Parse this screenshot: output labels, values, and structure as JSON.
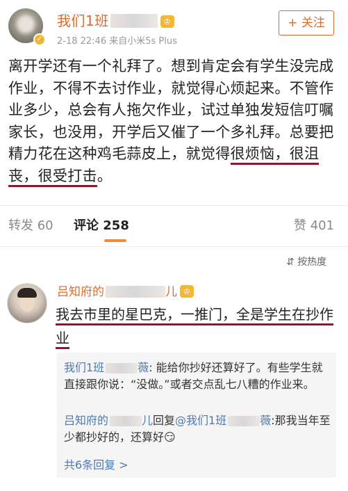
{
  "post": {
    "username": "我们1班",
    "vip_badge": "♔",
    "meta": "2-18 22:46  来自小米5s Plus",
    "follow_label": "+ 关注",
    "text_before_underline": "离开学还有一个礼拜了。想到肯定会有学生没完成作业，不得不去讨作业，就觉得心烦起来。不管作业多少，总会有人拖欠作业，试过单独发短信叮嘱家长，也没用，开学后又催了一个多礼拜。总要把精力花在这种鸡毛蒜皮上，就觉得",
    "text_underlined": "很烦恼，很沮丧，很受打击",
    "text_after_underline": "。"
  },
  "stats": {
    "repost": "转发 60",
    "comments": "评论 258",
    "likes": "赞 401"
  },
  "sort_label": "按热度",
  "sort_icon": "⇵",
  "comment": {
    "username": "吕知府的",
    "username_suffix": "儿",
    "text": "我去市里的星巴克，一推门，全是学生在抄作业"
  },
  "replies": [
    {
      "name": "我们1班",
      "name_tail": "薇",
      "text": ": 能给你抄好还算好了。有些学生就直接跟你说：“没做。”或者交点乱七八糟的作业来。"
    },
    {
      "name": "吕知府的",
      "name_tail": "儿",
      "text_prefix": "回复",
      "mention": "@我们1班",
      "mention_tail": "薇",
      "text": ":那我当年至少都抄好的，还算好",
      "emoji": "😏"
    }
  ],
  "more_replies": "共6条回复 >"
}
